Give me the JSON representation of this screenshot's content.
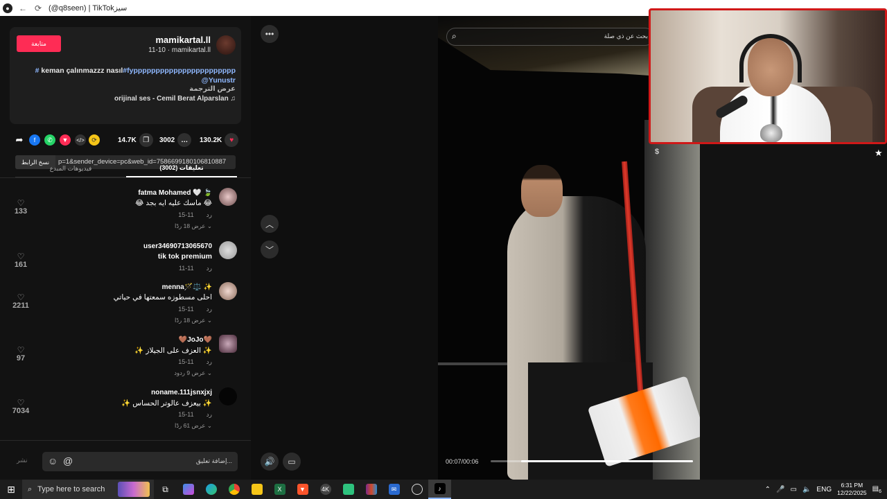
{
  "window": {
    "title": "(@q8seen) | TikTokسيز"
  },
  "video_card": {
    "follow_label": "متابعة",
    "author_name": "mamikartal.ll",
    "author_sub": "11-10 · mamikartal.ll",
    "caption_tag": "#fyppppppppppppppppppppppp",
    "caption_text": "keman çalınmazzz nasıl",
    "caption_tag2": "#",
    "caption_mention": "@Yunustr",
    "translate_label": "عرض الترجمة",
    "music": "orijinal ses - Cemil Berat Alparslan ♫"
  },
  "stats": {
    "likes": "130.2K",
    "comments": "3002",
    "saves": "14.7K"
  },
  "link": {
    "copy_label": "نسخ الرابط",
    "url_text": "p=1&sender_device=pc&web_id=7586699180106810887"
  },
  "tabs": {
    "comments": "(3002) تعليقات",
    "creator_videos": "فيديوهات المبدع"
  },
  "comments": [
    {
      "user": "fatma Mohamed 🤍 🍃",
      "text": "😂 ماسك عليه ايه بجد 😂",
      "date": "11-15",
      "reply": "رد",
      "more": "عرض 18 ردًا",
      "likes": "133"
    },
    {
      "user": "user34690713065670",
      "text": "tik tok premium",
      "date": "11-11",
      "reply": "رد",
      "more": "",
      "likes": "161"
    },
    {
      "user": "menna🪄⚖️ ✨",
      "text": "احلى مسطوزه سمعتها في حياتي",
      "date": "11-15",
      "reply": "رد",
      "more": "عرض 18 ردًا",
      "likes": "2211"
    },
    {
      "user": "🤎JoJo🤎",
      "text": "✨ العزف على الجيلاز ✨",
      "date": "11-15",
      "reply": "رد",
      "more": "عرض 9 ردود",
      "likes": "97"
    },
    {
      "user": "noname.111jsnxjxj",
      "text": "✨ بيعزف عالوتر الحساس ✨",
      "date": "11-15",
      "reply": "رد",
      "more": "عرض 61 ردًا",
      "likes": "7034"
    }
  ],
  "comment_input": {
    "post_label": "نشر",
    "placeholder": "إضافة تعليق..."
  },
  "video": {
    "search_placeholder": "بحث عن ذي صلة",
    "time": "00:07/00:06",
    "progress": 0.85
  },
  "overlay": {
    "dollar": "$",
    "star": "★"
  },
  "taskbar": {
    "search_placeholder": "Type here to search",
    "lang": "ENG",
    "time": "6:31 PM",
    "date": "12/22/2025",
    "notifications": "6"
  },
  "colors": {
    "accent": "#fe2c55",
    "link": "#8fb8ff",
    "webcam_border": "#d01818"
  }
}
